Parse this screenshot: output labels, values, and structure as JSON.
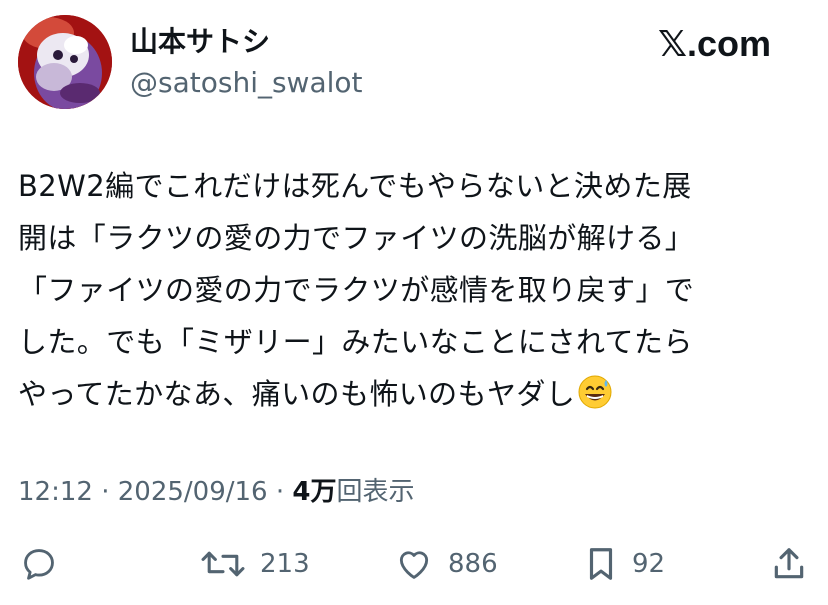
{
  "author": {
    "display_name": "山本サトシ",
    "handle": "@satoshi_swalot"
  },
  "brand": {
    "prefix": "𝕏",
    "suffix": ".com"
  },
  "tweet": {
    "lines": [
      "B2W2編でこれだけは死んでもやらないと決めた展",
      "開は「ラクツの愛の力でファイツの洗脳が解ける」",
      "「ファイツの愛の力でラクツが感情を取り戻す」で",
      "した。でも「ミザリー」みたいなことにされてたら",
      "やってたかなあ、痛いのも怖いのもヤダし"
    ],
    "emoji": "grinning-face-with-sweat-emoji"
  },
  "meta": {
    "time": "12:12",
    "separator": "·",
    "date": "2025/09/16",
    "views_count": "4万",
    "views_label": "回表示"
  },
  "actions": {
    "reply": {
      "icon": "reply-icon",
      "count": ""
    },
    "repost": {
      "icon": "repost-icon",
      "count": "213"
    },
    "like": {
      "icon": "heart-icon",
      "count": "886"
    },
    "bookmark": {
      "icon": "bookmark-icon",
      "count": "92"
    },
    "share": {
      "icon": "share-icon",
      "count": ""
    }
  },
  "colors": {
    "text": "#0f1419",
    "muted": "#536471",
    "avatar_bg": "#b01818"
  }
}
